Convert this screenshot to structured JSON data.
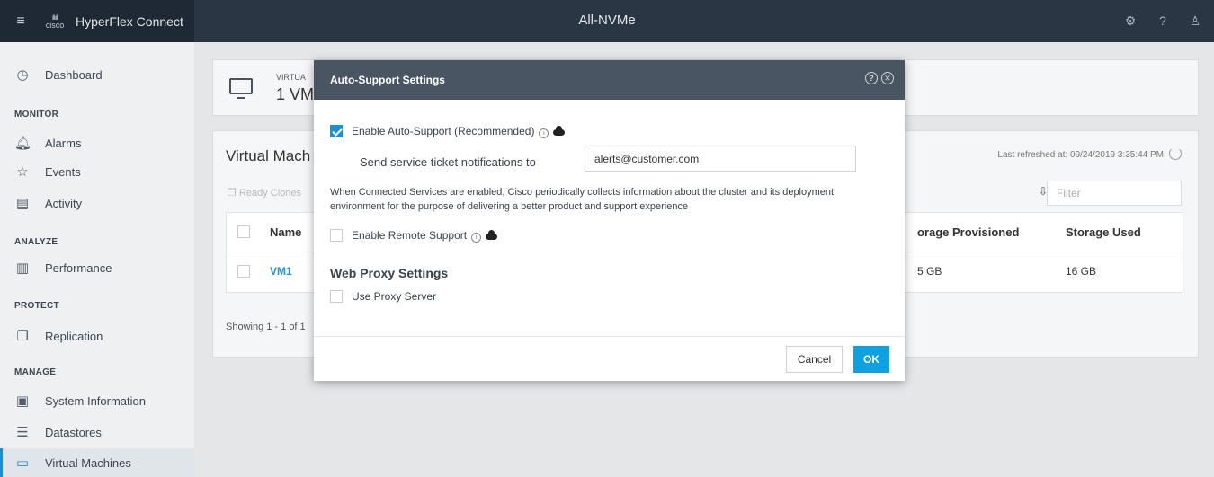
{
  "app": {
    "brand": "HyperFlex Connect",
    "logo_text": "cisco",
    "cluster_name": "All-NVMe"
  },
  "topbar": {
    "icons": [
      "gear-icon",
      "help-icon",
      "user-icon"
    ]
  },
  "sidebar": {
    "dashboard": "Dashboard",
    "monitor": {
      "heading": "MONITOR",
      "items": [
        "Alarms",
        "Events",
        "Activity"
      ]
    },
    "analyze": {
      "heading": "ANALYZE",
      "items": [
        "Performance"
      ]
    },
    "protect": {
      "heading": "PROTECT",
      "items": [
        "Replication"
      ]
    },
    "manage": {
      "heading": "MANAGE",
      "items": [
        "System Information",
        "Datastores",
        "Virtual Machines"
      ]
    }
  },
  "summary": {
    "label": "VIRTUA",
    "count": "1 VM"
  },
  "vm_panel": {
    "heading": "Virtual Mach",
    "ready_clones": "Ready Clones",
    "last_refreshed": "Last refreshed at: 09/24/2019 3:35:44 PM",
    "filter_placeholder": "Filter",
    "columns": {
      "name": "Name",
      "storage_provisioned": "orage Provisioned",
      "storage_used": "Storage Used"
    },
    "rows": [
      {
        "name": "VM1",
        "storage_provisioned": "5 GB",
        "storage_used": "16 GB"
      }
    ],
    "showing": "Showing 1 - 1 of 1"
  },
  "dialog": {
    "title": "Auto-Support Settings",
    "enable_auto_support": {
      "label": "Enable Auto-Support (Recommended)",
      "checked": true
    },
    "notify_label": "Send service ticket notifications to",
    "notify_value": "alerts@customer.com",
    "description": "When Connected Services are enabled, Cisco periodically collects information about the cluster and its deployment environment for the purpose of delivering a better product and support experience",
    "enable_remote_support": {
      "label": "Enable Remote Support",
      "checked": false
    },
    "proxy_heading": "Web Proxy Settings",
    "use_proxy": {
      "label": "Use Proxy Server",
      "checked": false
    },
    "cancel": "Cancel",
    "ok": "OK"
  }
}
